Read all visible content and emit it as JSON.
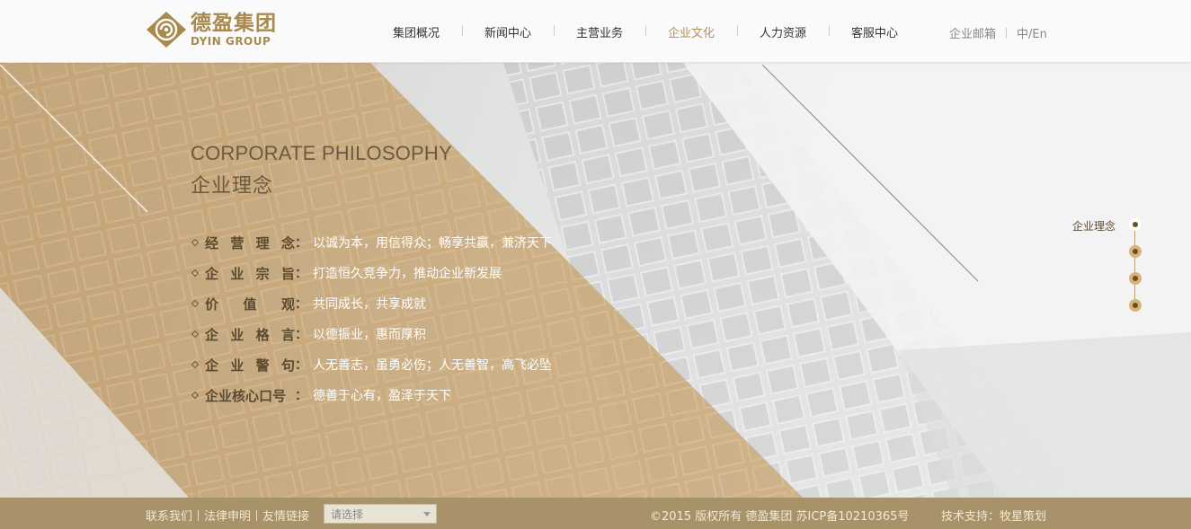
{
  "brand": {
    "name_cn": "德盈集团",
    "name_en": "DYIN GROUP",
    "accent": "#a98a4c"
  },
  "nav": {
    "items": [
      {
        "label": "集团概况"
      },
      {
        "label": "新闻中心"
      },
      {
        "label": "主营业务"
      },
      {
        "label": "企业文化",
        "active": true
      },
      {
        "label": "人力资源"
      },
      {
        "label": "客服中心"
      }
    ],
    "mail": "企业邮箱",
    "lang": "中/En"
  },
  "hero": {
    "title_en": "CORPORATE PHILOSOPHY",
    "title_cn": "企业理念",
    "items": [
      {
        "label": [
          "经",
          "营",
          "理",
          "念"
        ],
        "value": "以诚为本，用信得众；畅享共赢，兼济天下"
      },
      {
        "label": [
          "企",
          "业",
          "宗",
          "旨"
        ],
        "value": "打造恒久竞争力，推动企业新发展"
      },
      {
        "label": [
          "价",
          "值",
          "观"
        ],
        "value": "共同成长，共享成就"
      },
      {
        "label": [
          "企",
          "业",
          "格",
          "言"
        ],
        "value": "以德振业，惠而厚积"
      },
      {
        "label": [
          "企",
          "业",
          "警",
          "句"
        ],
        "value": "人无善志，虽勇必伤；人无善智，高飞必坠"
      },
      {
        "label": [
          "企",
          "业",
          "核",
          "心",
          "口",
          "号"
        ],
        "value": "德善于心有，盈泽于天下"
      }
    ],
    "colon": "："
  },
  "side_nav": {
    "label": "企业理念",
    "dots": 4,
    "active_index": 0
  },
  "footer": {
    "links": [
      "联系我们",
      "法律申明",
      "友情链接"
    ],
    "select_placeholder": "请选择",
    "copyright": "©2015 版权所有 德盈集团 苏ICP备10210365号",
    "tech": "技术支持：牧星策划",
    "bg": "#a8926a"
  }
}
